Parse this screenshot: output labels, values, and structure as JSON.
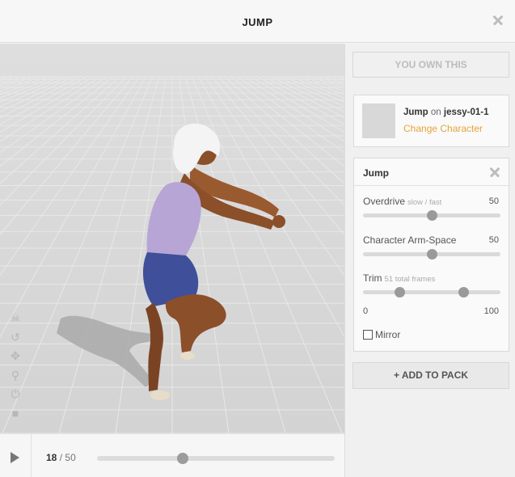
{
  "window": {
    "title": "JUMP"
  },
  "playback": {
    "current_frame": "18",
    "separator": "/",
    "total_frames": "50",
    "position_fraction": 0.36
  },
  "viewport": {
    "tools": [
      {
        "name": "skull-icon",
        "glyph": "☠"
      },
      {
        "name": "rotate-icon",
        "glyph": "↺"
      },
      {
        "name": "move-icon",
        "glyph": "✥"
      },
      {
        "name": "zoom-icon",
        "glyph": "⚲"
      },
      {
        "name": "power-icon",
        "glyph": "⏻"
      },
      {
        "name": "camera-icon",
        "glyph": "■"
      }
    ]
  },
  "sidebar": {
    "own_label": "YOU OWN THIS",
    "character": {
      "animation": "Jump",
      "connector": "on",
      "name": "jessy-01-1",
      "change_label": "Change Character"
    },
    "animation_panel": {
      "name": "Jump",
      "sliders": [
        {
          "label": "Overdrive",
          "hint": "slow / fast",
          "value": "50",
          "fraction": 0.5
        },
        {
          "label": "Character Arm-Space",
          "hint": "",
          "value": "50",
          "fraction": 0.5
        }
      ],
      "trim": {
        "label": "Trim",
        "hint": "51 total frames",
        "start_fraction": 0.27,
        "end_fraction": 0.73,
        "min_label": "0",
        "max_label": "100"
      },
      "mirror_label": "Mirror",
      "mirror_checked": false
    },
    "add_label": "+ ADD TO PACK"
  },
  "colors": {
    "accent": "#e6a339",
    "viewport_bg": "#d9d9d9",
    "knob": "#9a9a9a"
  }
}
